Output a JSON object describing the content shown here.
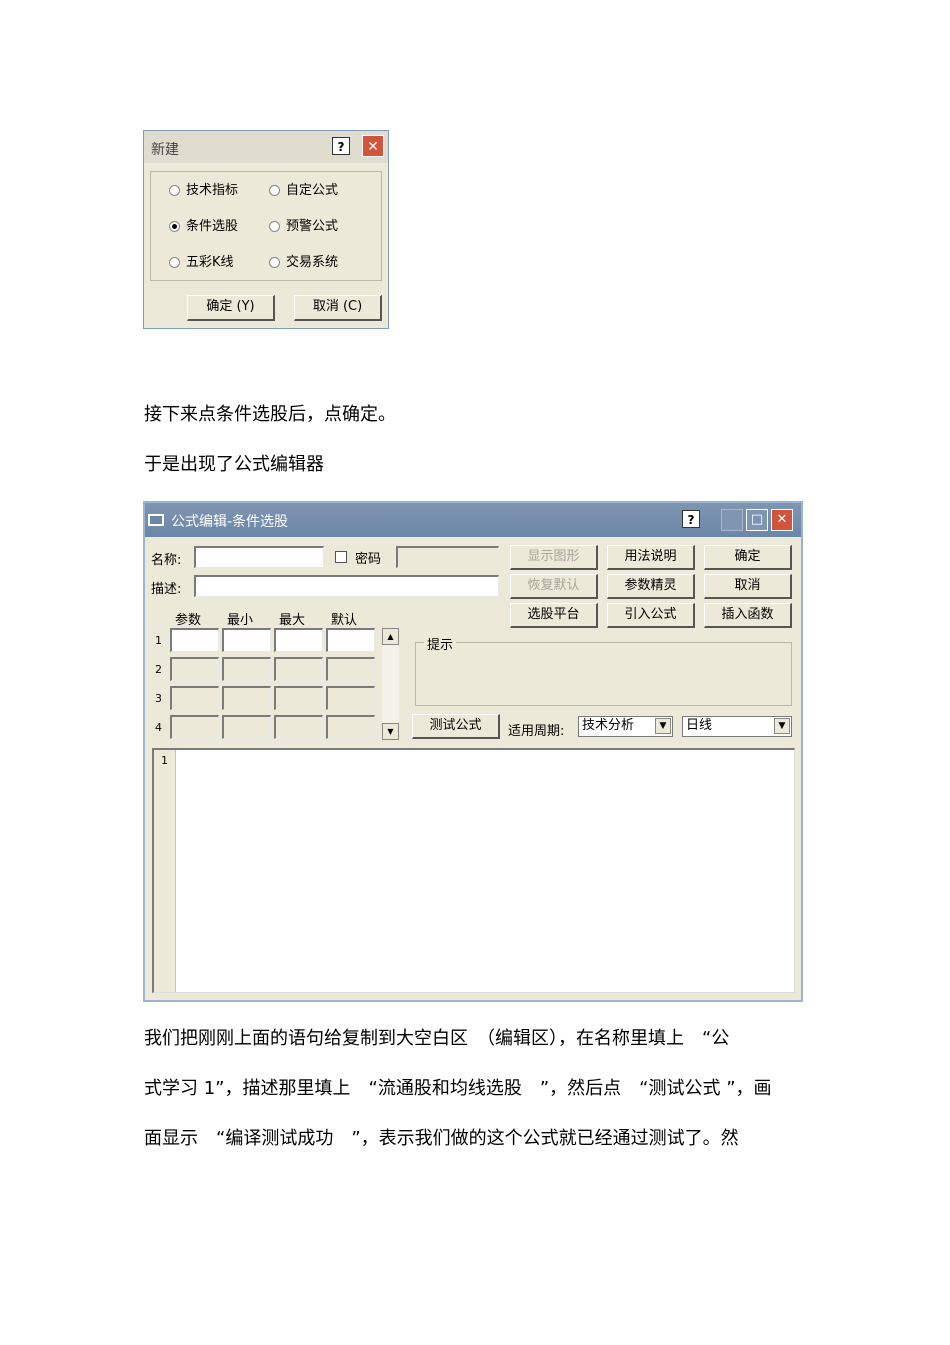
{
  "new_dialog": {
    "title": "新建",
    "help": "?",
    "close": "✕",
    "options": [
      {
        "label": "技术指标",
        "selected": false
      },
      {
        "label": "自定公式",
        "selected": false
      },
      {
        "label": "条件选股",
        "selected": true
      },
      {
        "label": "预警公式",
        "selected": false
      },
      {
        "label": "五彩K线",
        "selected": false
      },
      {
        "label": "交易系统",
        "selected": false
      }
    ],
    "ok": "确定 (Y)",
    "cancel": "取消 (C)"
  },
  "text": {
    "p1": "接下来点条件选股后，点确定。",
    "p2": "于是出现了公式编辑器",
    "p3_l1": "我们把刚刚上面的语句给复制到大空白区　（编辑区），在名称里填上　“公",
    "p3_l2": "式学习 1”，描述那里填上　“流通股和均线选股　”，然后点　“测试公式 ”，画",
    "p3_l3": "面显示　“编译测试成功　”，表示我们做的这个公式就已经通过测试了。然"
  },
  "editor_window": {
    "title": "公式编辑-条件选股",
    "help": "?",
    "name_label": "名称:",
    "name_value": "",
    "password_label": "密码",
    "password_value": "",
    "desc_label": "描述:",
    "desc_value": "",
    "buttons": {
      "show_graph": "显示图形",
      "usage": "用法说明",
      "confirm": "确定",
      "restore_default": "恢复默认",
      "param_wizard": "参数精灵",
      "cancel": "取消",
      "stock_platform": "选股平台",
      "import_formula": "引入公式",
      "insert_function": "插入函数",
      "test_formula": "测试公式"
    },
    "param_headers": [
      "参数",
      "最小",
      "最大",
      "默认"
    ],
    "param_rows": [
      "1",
      "2",
      "3",
      "4"
    ],
    "hint_legend": "提示",
    "period_label": "适用周期:",
    "analysis_select": "技术分析",
    "period_select": "日线",
    "line_number": "1"
  }
}
